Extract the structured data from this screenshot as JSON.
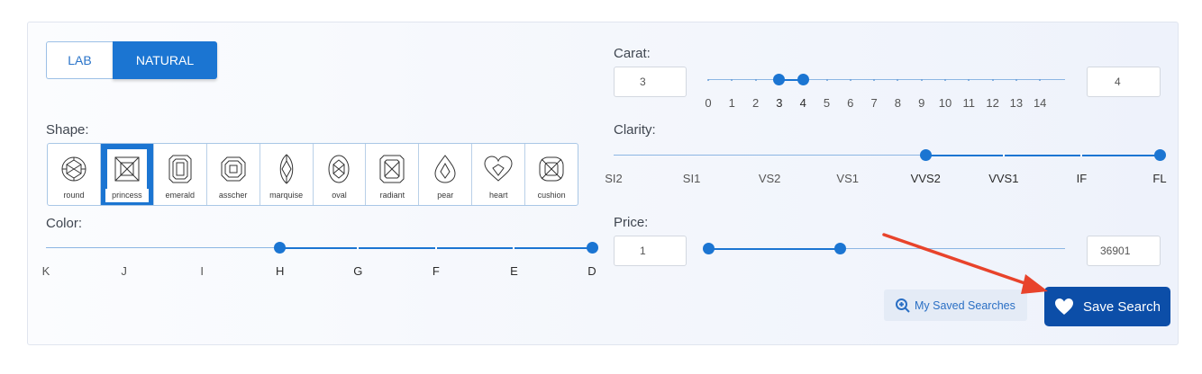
{
  "type_toggle": {
    "options": [
      "LAB",
      "NATURAL"
    ],
    "selected": "NATURAL"
  },
  "shape": {
    "label": "Shape:",
    "options": [
      "round",
      "princess",
      "emerald",
      "asscher",
      "marquise",
      "oval",
      "radiant",
      "pear",
      "heart",
      "cushion"
    ],
    "selected": "princess"
  },
  "color": {
    "label": "Color:",
    "ticks": [
      "K",
      "J",
      "I",
      "H",
      "G",
      "F",
      "E",
      "D"
    ],
    "range": [
      "H",
      "D"
    ]
  },
  "carat": {
    "label": "Carat:",
    "min_value": "3",
    "max_value": "4",
    "ticks": [
      "0",
      "1",
      "2",
      "3",
      "4",
      "5",
      "6",
      "7",
      "8",
      "9",
      "10",
      "11",
      "12",
      "13",
      "14"
    ],
    "range": [
      3,
      4
    ]
  },
  "clarity": {
    "label": "Clarity:",
    "ticks": [
      "SI2",
      "SI1",
      "VS2",
      "VS1",
      "VVS2",
      "VVS1",
      "IF",
      "FL"
    ],
    "range": [
      "VVS2",
      "FL"
    ]
  },
  "price": {
    "label": "Price:",
    "min_value": "1",
    "max_value": "36901",
    "range_fraction": [
      0,
      0.37
    ]
  },
  "actions": {
    "saved_searches": "My Saved Searches",
    "save_search": "Save Search"
  },
  "colors": {
    "accent": "#1b75d2",
    "save_button": "#0c4ea8",
    "arrow": "#e8432b"
  }
}
